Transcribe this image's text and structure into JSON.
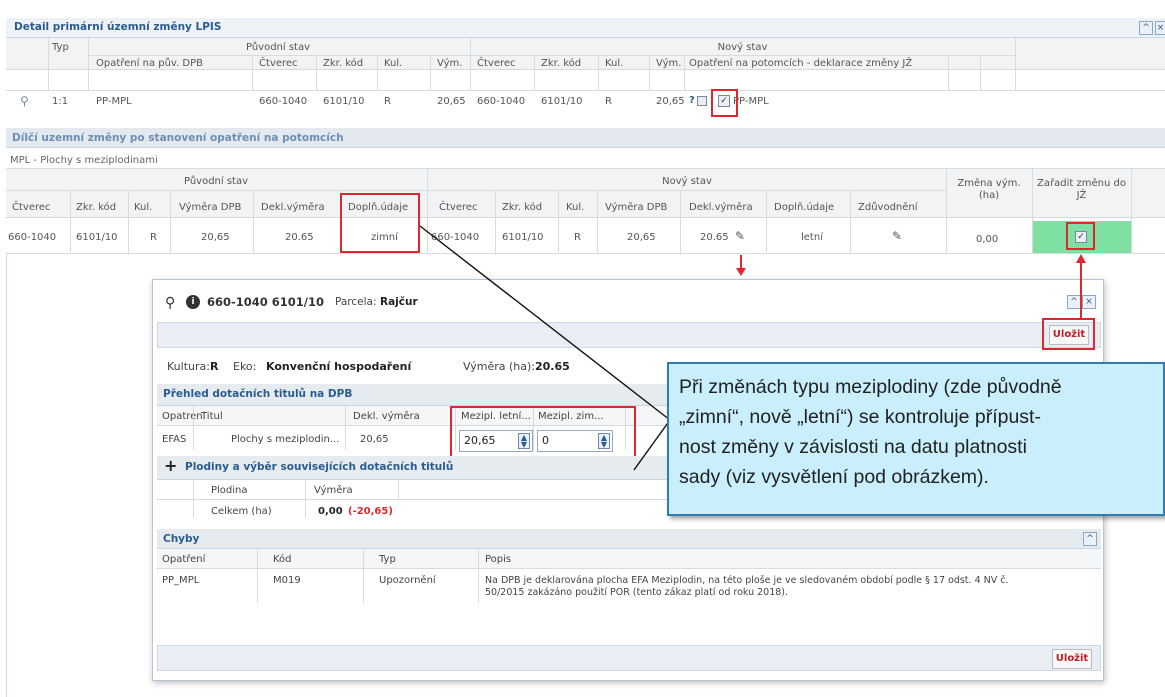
{
  "top": {
    "title": "Detail primární územní změny LPIS",
    "collapse_icon": "chevrons-up-icon",
    "close_icon": "close-icon",
    "group_original": "Původní stav",
    "group_new": "Nový stav",
    "col_typ": "Typ",
    "columns_orig": [
      "Opatření na pův. DPB",
      "Čtverec",
      "Zkr. kód",
      "Kul.",
      "Vým."
    ],
    "columns_new": [
      "Čtverec",
      "Zkr. kód",
      "Kul.",
      "Vým.",
      "Opatření na potomcích - deklarace změny JŽ"
    ],
    "row": {
      "typ": "1:1",
      "opatreni": "PP-MPL",
      "ctverec": "660-1040",
      "zkr": "6101/10",
      "kul": "R",
      "vym": "20,65",
      "n_ctverec": "660-1040",
      "n_zkr": "6101/10",
      "n_kul": "R",
      "n_vym": "20,65",
      "q_mark": "?",
      "n_opatreni": "PP-MPL"
    }
  },
  "sub": {
    "title": "Dílčí uzemní změny po stanovení opatření na potomcích",
    "group_label": "MPL - Plochy s meziplodinami",
    "group_original": "Původní stav",
    "group_new": "Nový stav",
    "columns_orig": [
      "Čtverec",
      "Zkr. kód",
      "Kul.",
      "Výměra DPB",
      "Dekl.výměra",
      "Doplň.údaje"
    ],
    "columns_new": [
      "Čtverec",
      "Zkr. kód",
      "Kul.",
      "Výměra DPB",
      "Dekl.výměra",
      "Doplň.údaje",
      "Zdůvodnění"
    ],
    "col_zmena": "Změna vým. (ha)",
    "col_zaradit": "Zařadit změnu do JŽ",
    "row": {
      "ctverec": "660-1040",
      "zkr": "6101/10",
      "kul": "R",
      "vym_dpb": "20,65",
      "dekl": "20.65",
      "dopln": "zimní",
      "n_ctverec": "660-1040",
      "n_zkr": "6101/10",
      "n_kul": "R",
      "n_vym_dpb": "20,65",
      "n_dekl": "20.65",
      "n_dopln": "letní",
      "zmena": "0,00"
    }
  },
  "modal": {
    "code": "660-1040 6101/10",
    "parcela_label": "Parcela:",
    "parcela_value": "Rajčur",
    "save_label": "Uložit",
    "kultura_label": "Kultura:",
    "kultura_value": "R",
    "eko_label": "Eko:",
    "eko_value": "Konvenční hospodaření",
    "vymera_label": "Výměra (ha):",
    "vymera_value": "20.65",
    "titles_header": "Přehled dotačních titulů na DPB",
    "titles_columns": [
      "Opatreni",
      "Titul",
      "Dekl. výměra",
      "Mezipl. letní...",
      "Mezipl. zim..."
    ],
    "titles_row": {
      "opatreni": "EFAS",
      "titul": "Plochy s meziplodin...",
      "dekl": "20,65",
      "letni": "20,65",
      "zimni": "0"
    },
    "crops_header": "Plodiny a výběr souvisejících dotačních titulů",
    "crops_columns": [
      "Plodina",
      "Výměra"
    ],
    "crops_total_label": "Celkem (ha)",
    "crops_total_value": "0,00",
    "crops_total_diff": "(-20,65)",
    "errors_header": "Chyby",
    "errors_columns": [
      "Opatření",
      "Kód",
      "Typ",
      "Popis"
    ],
    "errors_row": {
      "opatreni": "PP_MPL",
      "kod": "M019",
      "typ": "Upozornění",
      "popis_line1": "Na DPB je deklarována plocha EFA Meziplodin, na této ploše je ve sledovaném období podle § 17 odst. 4 NV č.",
      "popis_line2": "50/2015 zakázáno použití POR (tento zákaz platí od roku 2018)."
    }
  },
  "callout": {
    "line1": "Při změnách typu meziplodiny (zde původně",
    "line2": "„zimní“, nově „letní“) se kontroluje přípust-",
    "line3": "nost změny v závislosti na datu platnosti",
    "line4": "sady (viz vysvětlení pod obrázkem)."
  },
  "colors": {
    "accent": "#2a5c92",
    "highlight_red": "#e0262f",
    "green_cell": "#7fe0a3",
    "callout_bg": "#c9eefc"
  }
}
